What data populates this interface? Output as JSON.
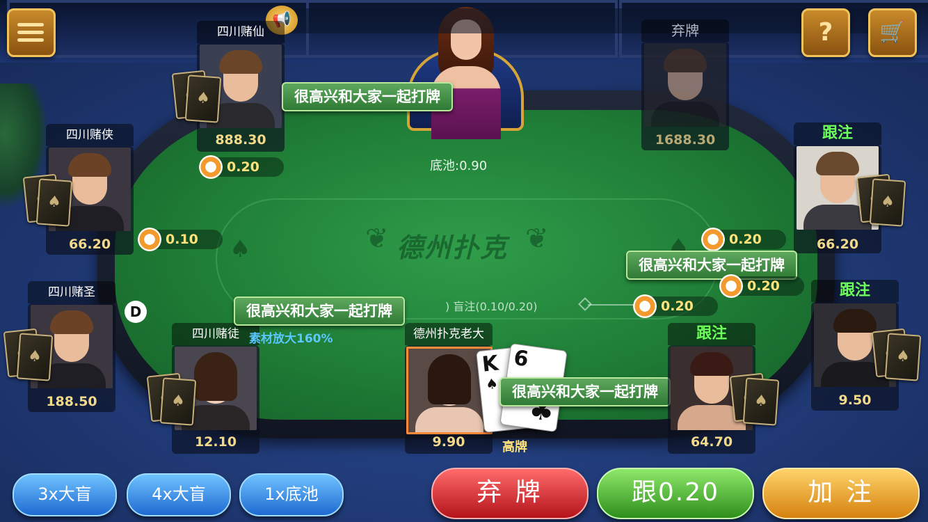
{
  "table": {
    "pot_label": "底池:0.90",
    "blinds_label": ") 盲注(0.10/0.20)",
    "logo_text": "德州扑克",
    "dealer_button": "D"
  },
  "toolbar": {
    "menu_icon": "menu-icon",
    "help_label": "?",
    "cart_label": "🛒"
  },
  "players": {
    "p_sichuan_xian": {
      "name": "四川赌仙",
      "chips": "888.30",
      "bet": "0.20"
    },
    "p_fold_top": {
      "status": "弃牌",
      "chips": "1688.30"
    },
    "p_sichuan_xia": {
      "name": "四川赌侠",
      "chips": "66.20",
      "bet": "0.10"
    },
    "p_right_top": {
      "status": "跟注",
      "chips": "66.20",
      "bet": "0.20"
    },
    "p_sichuan_sheng": {
      "name": "四川赌圣",
      "chips": "188.50"
    },
    "p_right_mid": {
      "status": "跟注",
      "chips": "9.50",
      "bet": "0.20"
    },
    "p_sichuan_tu": {
      "name": "四川赌徒",
      "chips": "12.10"
    },
    "p_hero": {
      "name": "德州扑克老大",
      "chips": "9.90",
      "hand_rank": "高牌",
      "card1_rank": "K",
      "card1_suit": "♠",
      "card2_rank": "6",
      "card2_suit": "♣"
    },
    "p_bottom_right": {
      "status": "跟注",
      "chips": "64.70",
      "bet": "0.20"
    }
  },
  "chat": {
    "msg1": "很高兴和大家一起打牌",
    "msg2": "很高兴和大家一起打牌",
    "msg3": "很高兴和大家一起打牌",
    "msg4": "很高兴和大家一起打牌"
  },
  "overlay": {
    "zoom_note": "素材放大160%"
  },
  "quick_bets": {
    "b3x": "3x大盲",
    "b4x": "4x大盲",
    "b1x": "1x底池"
  },
  "actions": {
    "fold": "弃 牌",
    "call": "跟0.20",
    "raise": "加 注"
  }
}
